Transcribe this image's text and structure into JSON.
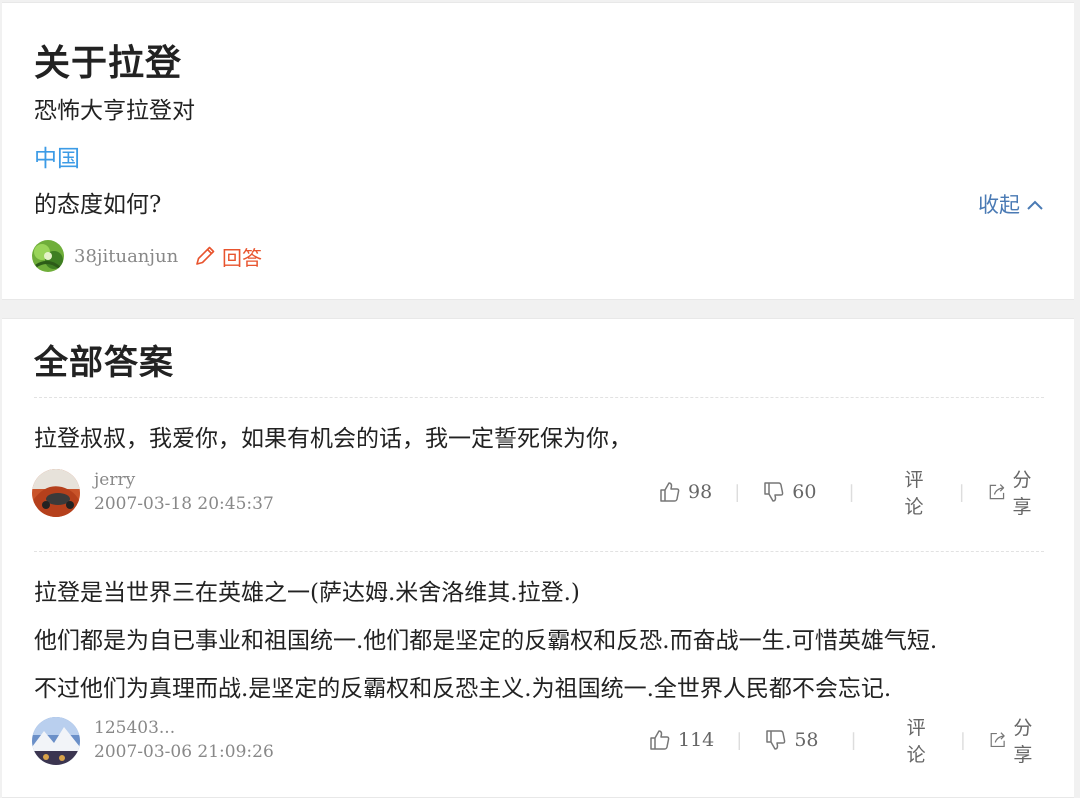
{
  "question": {
    "title": "关于拉登",
    "line1": "恐怖大亨拉登对",
    "link": "中国",
    "line3": "的态度如何?",
    "collapse_label": "收起",
    "asker": "38jituanjun",
    "answer_label": "回答"
  },
  "answers_section": {
    "title": "全部答案",
    "comment_label": "评论",
    "share_label": "分享",
    "answers": [
      {
        "text": [
          " 拉登叔叔，我爱你，如果有机会的话，我一定誓死保为你，"
        ],
        "user": "jerry",
        "time": "2007-03-18 20:45:37",
        "likes": "98",
        "dislikes": "60"
      },
      {
        "text": [
          "拉登是当世界三在英雄之一(萨达姆.米舍洛维其.拉登.)",
          "他们都是为自已事业和祖国统一.他们都是坚定的反霸权和反恐.而奋战一生.可惜英雄气短.",
          "不过他们为真理而战.是坚定的反霸权和反恐主义.为祖国统一.全世界人民都不会忘记."
        ],
        "user": "125403...",
        "time": "2007-03-06 21:09:26",
        "likes": "114",
        "dislikes": "58"
      }
    ]
  }
}
